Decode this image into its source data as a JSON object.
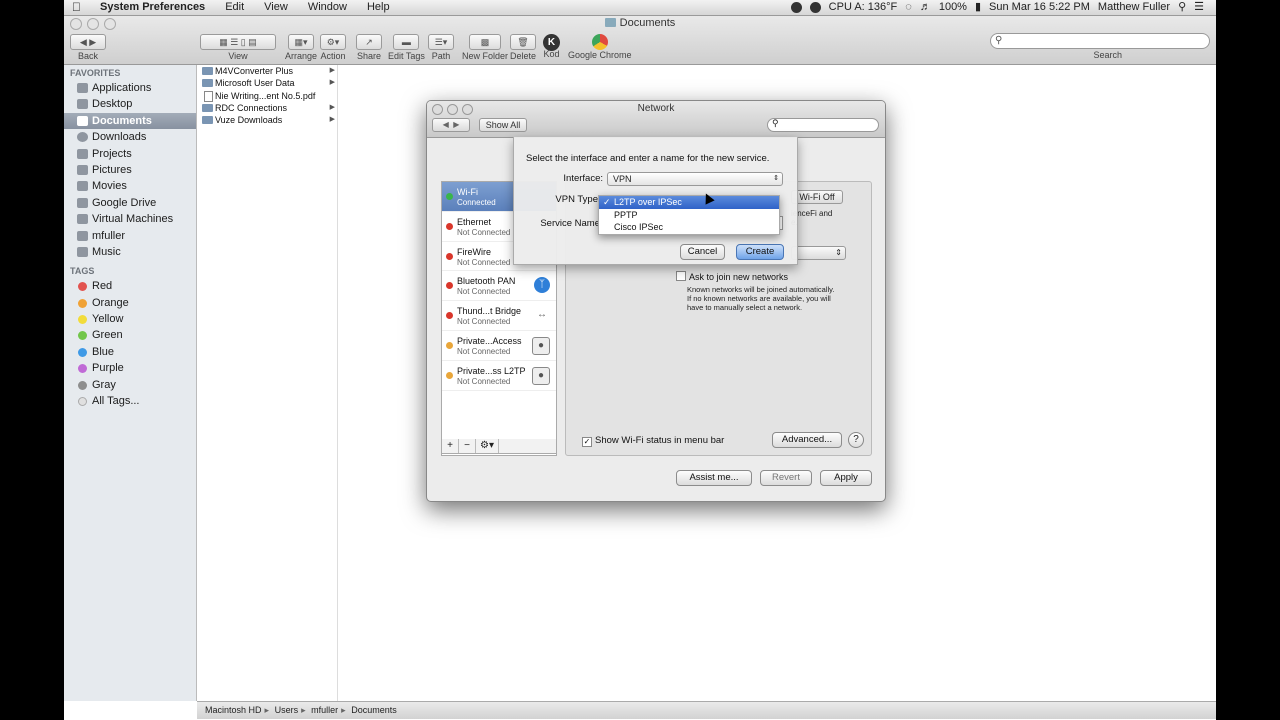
{
  "menubar": {
    "app": "System Preferences",
    "menus": [
      "Edit",
      "View",
      "Window",
      "Help"
    ],
    "cpu": "CPU A: 136°F",
    "battery": "100%",
    "datetime": "Sun Mar 16  5:22 PM",
    "user": "Matthew Fuller"
  },
  "finder": {
    "title": "Documents",
    "toolbar": {
      "back": "Back",
      "view": "View",
      "arrange": "Arrange",
      "action": "Action",
      "share": "Share",
      "edit_tags": "Edit Tags",
      "path": "Path",
      "new_folder": "New Folder",
      "delete": "Delete",
      "kod": "Kod",
      "chrome": "Google Chrome",
      "search": "Search"
    },
    "sidebar": {
      "favorites_header": "FAVORITES",
      "favorites": [
        "Applications",
        "Desktop",
        "Documents",
        "Downloads",
        "Projects",
        "Pictures",
        "Movies",
        "Google Drive",
        "Virtual Machines",
        "mfuller",
        "Music"
      ],
      "tags_header": "TAGS",
      "tags": [
        {
          "label": "Red",
          "color": "#e2534f"
        },
        {
          "label": "Orange",
          "color": "#f0a236"
        },
        {
          "label": "Yellow",
          "color": "#f2dc3a"
        },
        {
          "label": "Green",
          "color": "#72c64a"
        },
        {
          "label": "Blue",
          "color": "#3f9ae6"
        },
        {
          "label": "Purple",
          "color": "#c06ad6"
        },
        {
          "label": "Gray",
          "color": "#8e8e8e"
        },
        {
          "label": "All Tags...",
          "color": "#cfcfcf"
        }
      ]
    },
    "files": [
      {
        "name": "M4VConverter Plus",
        "kind": "folder"
      },
      {
        "name": "Microsoft User Data",
        "kind": "folder"
      },
      {
        "name": "Nie Writing...ent No.5.pdf",
        "kind": "doc"
      },
      {
        "name": "RDC Connections",
        "kind": "folder"
      },
      {
        "name": "Vuze Downloads",
        "kind": "folder"
      }
    ],
    "path": [
      "Macintosh HD",
      "Users",
      "mfuller",
      "Documents"
    ]
  },
  "network": {
    "title": "Network",
    "show_all": "Show All",
    "services": [
      {
        "name": "Wi-Fi",
        "status": "Connected",
        "dot": "#39b54a",
        "icon": ""
      },
      {
        "name": "Ethernet",
        "status": "Not Connected",
        "dot": "#d9362b",
        "icon": ""
      },
      {
        "name": "FireWire",
        "status": "Not Connected",
        "dot": "#d9362b",
        "icon": ""
      },
      {
        "name": "Bluetooth PAN",
        "status": "Not Connected",
        "dot": "#d9362b",
        "icon": "bluetooth-icon"
      },
      {
        "name": "Thund...t Bridge",
        "status": "Not Connected",
        "dot": "#d9362b",
        "icon": "thunderbolt-icon"
      },
      {
        "name": "Private...Access",
        "status": "Not Connected",
        "dot": "#e9a63a",
        "icon": "lock-icon"
      },
      {
        "name": "Private...ss L2TP",
        "status": "Not Connected",
        "dot": "#e9a63a",
        "icon": "lock-icon"
      }
    ],
    "wifi_off": "Wi-Fi Off",
    "wifi_desc": "ienceFi and\ne.",
    "ask_join": "Ask to join new networks",
    "ask_desc": "Known networks will be joined automatically.\nIf no known networks are available, you will\nhave to manually select a network.",
    "show_wifi_status": "Show Wi-Fi status in menu bar",
    "advanced": "Advanced...",
    "help": "?",
    "assist": "Assist me...",
    "revert": "Revert",
    "apply": "Apply"
  },
  "sheet": {
    "instruction": "Select the interface and enter a name for the new service.",
    "interface_label": "Interface:",
    "interface_value": "VPN",
    "vpn_type_label": "VPN Type",
    "service_name_label": "Service Name",
    "vpn_options": [
      "L2TP over IPSec",
      "PPTP",
      "Cisco IPSec"
    ],
    "selected_option": "L2TP over IPSec",
    "cancel": "Cancel",
    "create": "Create"
  }
}
